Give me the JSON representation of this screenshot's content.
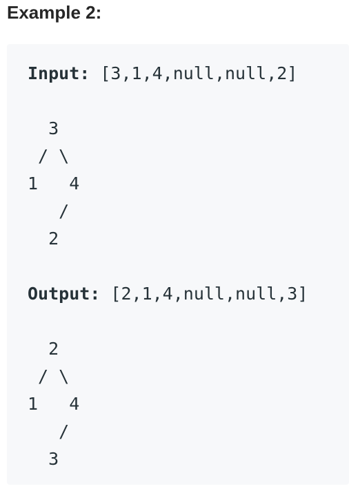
{
  "heading": "Example 2:",
  "input": {
    "label": "Input:",
    "value": "[3,1,4,null,null,2]",
    "tree": [
      "  3",
      " / \\",
      "1   4",
      "   /",
      "  2"
    ]
  },
  "output": {
    "label": "Output:",
    "value": "[2,1,4,null,null,3]",
    "tree": [
      "  2",
      " / \\",
      "1   4",
      "   /",
      "  3"
    ]
  }
}
